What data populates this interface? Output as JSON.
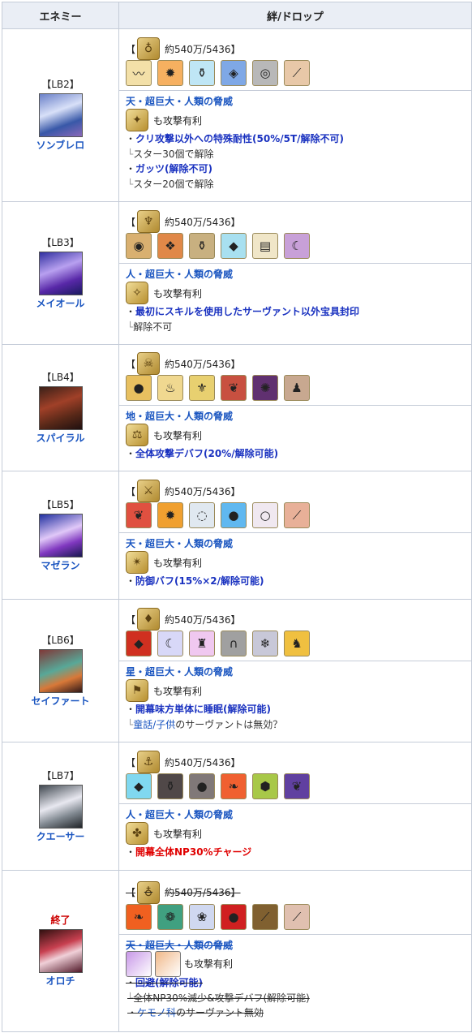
{
  "header": {
    "enemy": "エネミー",
    "drops": "絆/ドロップ"
  },
  "rows": [
    {
      "lb": "【LB2】",
      "name": "ソンブレロ",
      "ended": "",
      "bond_open": "【",
      "bond_value": "約540万/5436】",
      "bond_symbol": "♁",
      "items": [
        "〰",
        "✹",
        "⚱",
        "◈",
        "◎",
        "⟋"
      ],
      "item_colors": [
        "#f3e0a8",
        "#f6b060",
        "#bfe6f5",
        "#7fa8e6",
        "#b8b8b8",
        "#e8c8a8"
      ],
      "trait": "天・超巨大・人類の脅威",
      "class_symbol": "✦",
      "adv": "も攻撃有利",
      "abilities": [
        {
          "text": "クリ攻撃以外への特殊耐性(50%/5T/解除不可)",
          "sub": "スター30個で解除"
        },
        {
          "text": "ガッツ(解除不可)",
          "sub": "スター20個で解除"
        }
      ]
    },
    {
      "lb": "【LB3】",
      "name": "メイオール",
      "ended": "",
      "bond_open": "【",
      "bond_value": "約540万/5436】",
      "bond_symbol": "♆",
      "items": [
        "◉",
        "❖",
        "⚱",
        "◆",
        "▤",
        "☾"
      ],
      "item_colors": [
        "#d9b070",
        "#e08848",
        "#c8b080",
        "#a8e0f0",
        "#f0e6c8",
        "#c8a0d8"
      ],
      "trait": "人・超巨大・人類の脅威",
      "class_symbol": "✧",
      "adv": "も攻撃有利",
      "abilities": [
        {
          "text": "最初にスキルを使用したサーヴァント以外宝具封印",
          "sub": "解除不可"
        }
      ]
    },
    {
      "lb": "【LB4】",
      "name": "スパイラル",
      "ended": "",
      "bond_open": "【",
      "bond_value": "約540万/5436】",
      "bond_symbol": "☠",
      "items": [
        "●",
        "♨",
        "⚜",
        "❦",
        "✺",
        "♟"
      ],
      "item_colors": [
        "#e8c060",
        "#f0d890",
        "#e8d070",
        "#c85040",
        "#603070",
        "#c8a890"
      ],
      "trait": "地・超巨大・人類の脅威",
      "class_symbol": "⚖",
      "adv": "も攻撃有利",
      "abilities": [
        {
          "text": "全体攻撃デバフ(20%/解除可能)",
          "sub": ""
        }
      ]
    },
    {
      "lb": "【LB5】",
      "name": "マゼラン",
      "ended": "",
      "bond_open": "【",
      "bond_value": "約540万/5436】",
      "bond_symbol": "⚔",
      "items": [
        "❦",
        "✹",
        "◌",
        "●",
        "○",
        "⟋"
      ],
      "item_colors": [
        "#e05040",
        "#f0a030",
        "#e0e8f0",
        "#60b8f0",
        "#f0e8f0",
        "#e8b098"
      ],
      "trait": "天・超巨大・人類の脅威",
      "class_symbol": "✴",
      "adv": "も攻撃有利",
      "abilities": [
        {
          "text": "防御バフ(15%×2/解除可能)",
          "sub": ""
        }
      ]
    },
    {
      "lb": "【LB6】",
      "name": "セイファート",
      "ended": "",
      "bond_open": "【",
      "bond_value": "約540万/5436】",
      "bond_symbol": "♦",
      "items": [
        "◆",
        "☾",
        "♜",
        "∩",
        "❄",
        "♞"
      ],
      "item_colors": [
        "#d03020",
        "#d8d8f8",
        "#f0c8f0",
        "#a0a0a0",
        "#c8c8d8",
        "#f0c040"
      ],
      "trait": "星・超巨大・人類の脅威",
      "class_symbol": "⚑",
      "adv": "も攻撃有利",
      "abilities": [
        {
          "text": "開幕味方単体に睡眠(解除可能)",
          "sub": "",
          "sub_link": "童話/子供",
          "sub_rest": "のサーヴァントは無効？"
        }
      ]
    },
    {
      "lb": "【LB7】",
      "name": "クエーサー",
      "ended": "",
      "bond_open": "【",
      "bond_value": "約540万/5436】",
      "bond_symbol": "⚓",
      "items": [
        "◆",
        "⚱",
        "●",
        "❧",
        "⬢",
        "❦"
      ],
      "item_colors": [
        "#80d8f0",
        "#504848",
        "#807878",
        "#f06030",
        "#a8c848",
        "#6040a0"
      ],
      "trait": "人・超巨大・人類の脅威",
      "class_symbol": "✤",
      "adv": "も攻撃有利",
      "abilities": [
        {
          "text": "開幕全体NP30%チャージ",
          "sub": "",
          "red": true
        }
      ]
    },
    {
      "lb": "",
      "name": "オロチ",
      "ended": "終了",
      "bond_open": "【",
      "bond_value": "約540万/5436】",
      "bond_symbol": "♁",
      "items": [
        "❧",
        "❁",
        "❀",
        "●",
        "⟋",
        "⟋"
      ],
      "item_colors": [
        "#f06020",
        "#40a080",
        "#d0d8f0",
        "#d02020",
        "#806030",
        "#e0c0b0"
      ],
      "trait": "天・超巨大・人類の脅威",
      "class_symbol": "",
      "adv": "も攻撃有利",
      "servants": [
        "#c898e8",
        "#f0b888"
      ],
      "abilities": [
        {
          "text": "回避(解除可能)",
          "sub": "全体NP30%減少&攻撃デバフ(解除可能)",
          "sub_link": "ケモノ科",
          "sub_rest": "のサーヴァント無効"
        }
      ]
    }
  ]
}
